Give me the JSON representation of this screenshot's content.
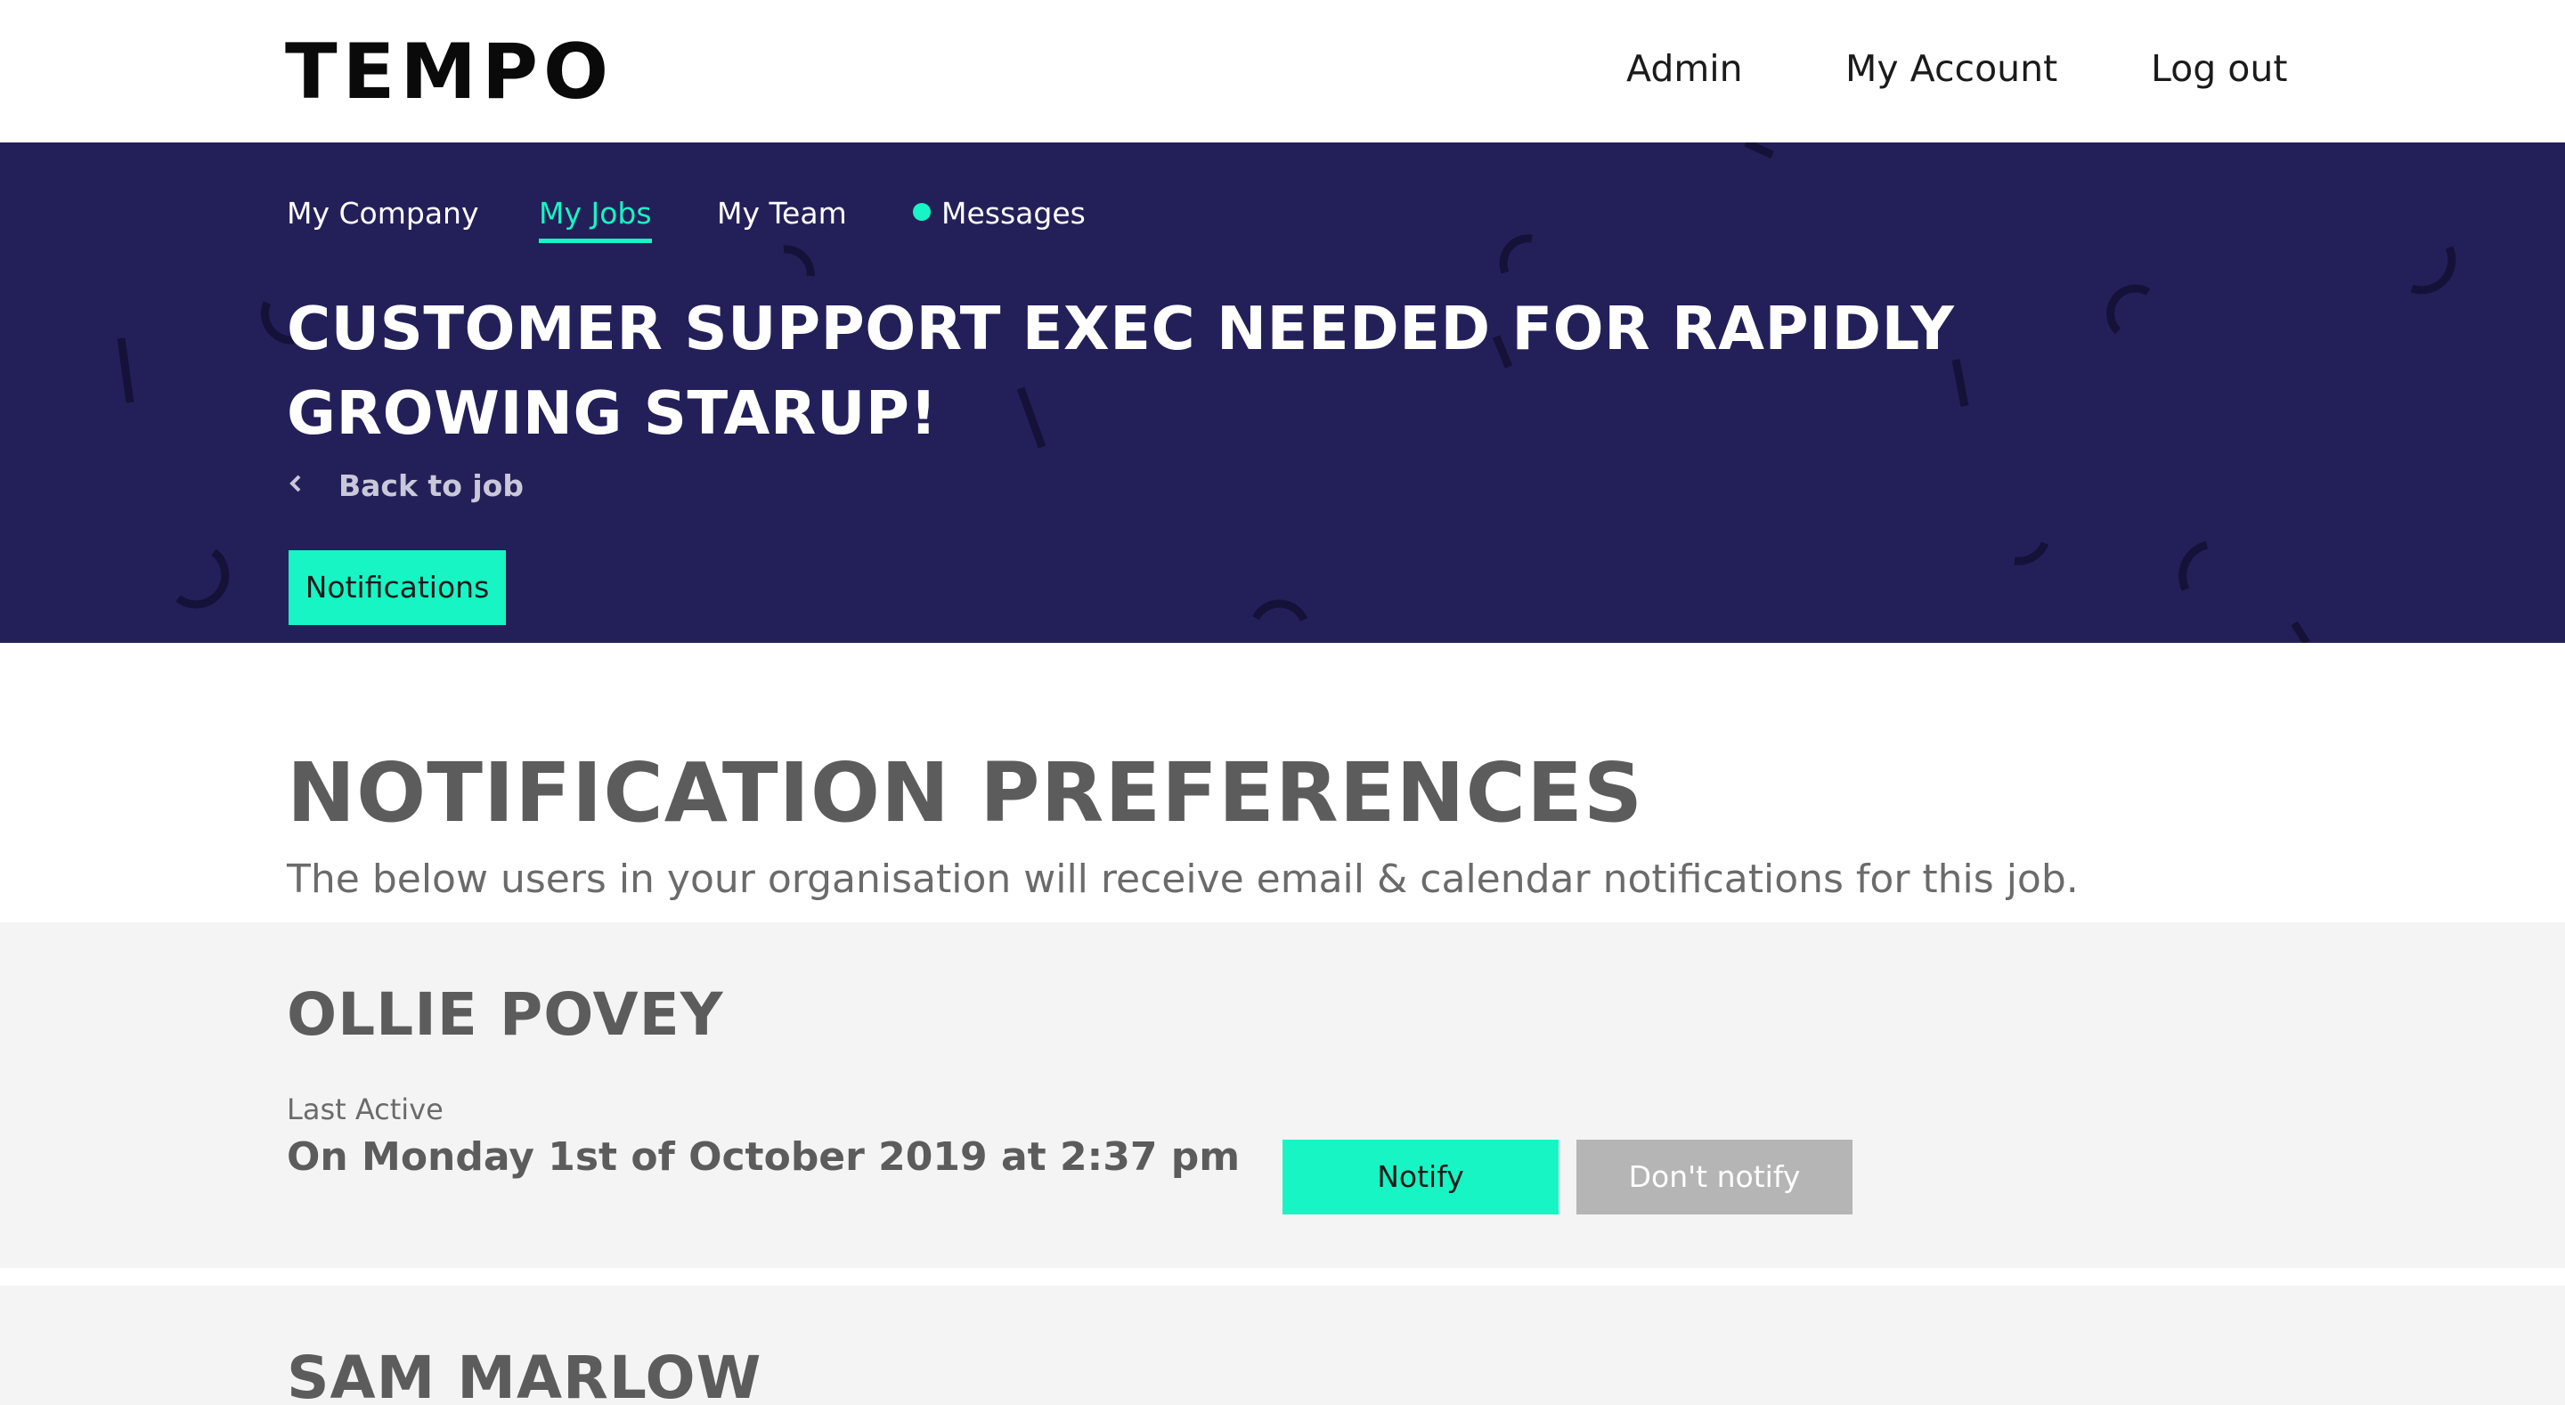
{
  "header": {
    "logo": "TEMPO",
    "nav": {
      "admin": "Admin",
      "account": "My Account",
      "logout": "Log out"
    }
  },
  "subnav": {
    "company": "My Company",
    "jobs": "My Jobs",
    "team": "My Team",
    "messages": "Messages"
  },
  "hero": {
    "title": "CUSTOMER SUPPORT EXEC NEEDED FOR RAPIDLY GROWING STARUP!",
    "back_label": "Back to job",
    "notifications_button": "Notifications"
  },
  "colors": {
    "hero_bg": "#232059",
    "accent": "#17f5c4",
    "card_bg": "#f4f4f4",
    "dont_notify_bg": "#b5b5b5"
  },
  "main": {
    "title": "NOTIFICATION PREFERENCES",
    "subtitle": "The below users in your organisation will receive email & calendar notifications for this job.",
    "users": [
      {
        "name": "OLLIE POVEY",
        "last_active_label": "Last Active",
        "last_active_value": "On Monday 1st of October 2019 at 2:37 pm",
        "notify_label": "Notify",
        "dont_notify_label": "Don't notify"
      },
      {
        "name": "SAM MARLOW"
      }
    ]
  }
}
